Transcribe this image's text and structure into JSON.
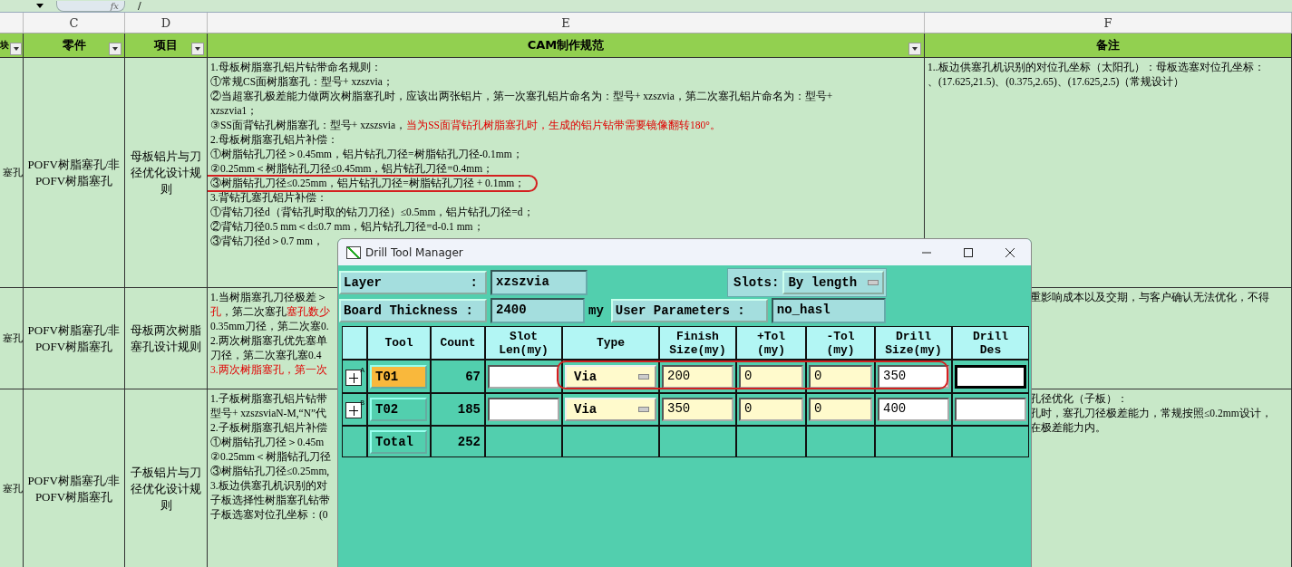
{
  "formula_bar": {
    "fx_label": "fx",
    "formula": "/"
  },
  "column_letters": [
    "C",
    "D",
    "E",
    "F"
  ],
  "header_row": [
    {
      "label": "块",
      "filter": true
    },
    {
      "label": "零件",
      "filter": true
    },
    {
      "label": "项目",
      "filter": true
    },
    {
      "label": "CAM制作规范",
      "filter": true
    },
    {
      "label": "备注",
      "filter": false
    }
  ],
  "rows": [
    {
      "module": "塞孔",
      "part": "POFV树脂塞孔/非POFV树脂塞孔",
      "item": "母板铝片与刀径优化设计规则",
      "spec": [
        {
          "segments": [
            {
              "text": "1.母板树脂塞孔铝片钻带命名规则：",
              "red": false
            }
          ]
        },
        {
          "segments": [
            {
              "text": "①常规CS面树脂塞孔：型号+ xzszvia；",
              "red": false
            }
          ]
        },
        {
          "segments": [
            {
              "text": "②当超塞孔极差能力做两次树脂塞孔时，应该出两张铝片，第一次塞孔铝片命名为：型号+ xzszvia，第二次塞孔铝片命名为：型号+",
              "red": false
            }
          ]
        },
        {
          "segments": [
            {
              "text": "xzszvia1；",
              "red": false
            }
          ]
        },
        {
          "segments": [
            {
              "text": "③SS面背钻孔树脂塞孔：型号+ xzszsvia，",
              "red": false
            },
            {
              "text": "当为SS面背钻孔树脂塞孔时，生成的铝片钻带需要镜像翻转180°。",
              "red": true
            }
          ]
        },
        {
          "segments": [
            {
              "text": "2.母板树脂塞孔铝片补偿：",
              "red": false
            }
          ]
        },
        {
          "segments": [
            {
              "text": "①树脂钻孔刀径＞0.45mm，铝片钻孔刀径=树脂钻孔刀径-0.1mm；",
              "red": false
            }
          ]
        },
        {
          "segments": [
            {
              "text": "②0.25mm＜树脂钻孔刀径≤0.45mm，铝片钻孔刀径=0.4mm；",
              "red": false
            }
          ]
        },
        {
          "segments": [
            {
              "text": "③树脂钻孔刀径≤0.25mm，铝片钻孔刀径=树脂钻孔刀径 + 0.1mm；",
              "red": false
            }
          ],
          "annotated": true
        },
        {
          "segments": [
            {
              "text": "3.背钻孔塞孔铝片补偿：",
              "red": false
            }
          ]
        },
        {
          "segments": [
            {
              "text": "①背钻刀径d（背钻孔时取的钻刀刀径）≤0.5mm，铝片钻孔刀径=d；",
              "red": false
            }
          ]
        },
        {
          "segments": [
            {
              "text": "②背钻刀径0.5 mm＜d≤0.7 mm，铝片钻孔刀径=d-0.1 mm；",
              "red": false
            }
          ]
        },
        {
          "segments": [
            {
              "text": "③背钻刀径d＞0.7 mm，",
              "red": false
            }
          ]
        }
      ],
      "note": [
        "1..板边供塞孔机识别的对位孔坐标（太阳孔）：母板选塞对位孔坐标：",
        "、(17.625,21.5)、(0.375,2.65)、(17.625,2.5)（常规设计）"
      ]
    },
    {
      "module": "塞孔",
      "part": "POFV树脂塞孔/非POFV树脂塞孔",
      "item": "母板两次树脂塞孔设计规则",
      "spec": [
        {
          "segments": [
            {
              "text": "1.当树脂塞孔刀径极差＞",
              "red": false
            }
          ]
        },
        {
          "segments": [
            {
              "text": "孔",
              "red": true
            },
            {
              "text": "，第二次塞孔",
              "red": false
            },
            {
              "text": "塞孔数少",
              "red": true
            }
          ]
        },
        {
          "segments": [
            {
              "text": "0.35mm刀径，第二次塞0.",
              "red": false
            }
          ]
        },
        {
          "segments": [
            {
              "text": "2.两次树脂塞孔优先塞单",
              "red": false
            }
          ]
        },
        {
          "segments": [
            {
              "text": "刀径，第二次塞孔塞0.4",
              "red": false
            }
          ]
        },
        {
          "segments": [
            {
              "text": "3.两次树脂塞孔，第一次",
              "red": true
            }
          ]
        }
      ],
      "note": [
        "重影响成本以及交期，与客户确认无法优化，不得"
      ]
    },
    {
      "module": "塞孔",
      "part": "POFV树脂塞孔/非POFV树脂塞孔",
      "item": "子板铝片与刀径优化设计规则",
      "spec": [
        {
          "segments": [
            {
              "text": "1.子板树脂塞孔铝片钻带",
              "red": false
            }
          ]
        },
        {
          "segments": [
            {
              "text": "型号+ xzszsviaN-M,“N”代",
              "red": false
            }
          ]
        },
        {
          "segments": [
            {
              "text": "2.子板树脂塞孔铝片补偿",
              "red": false
            }
          ]
        },
        {
          "segments": [
            {
              "text": "①树脂钻孔刀径＞0.45m",
              "red": false
            }
          ]
        },
        {
          "segments": [
            {
              "text": "②0.25mm＜树脂钻孔刀径",
              "red": false
            }
          ]
        },
        {
          "segments": [
            {
              "text": "③树脂钻孔刀径≤0.25mm,",
              "red": false
            }
          ]
        },
        {
          "segments": [
            {
              "text": "3.板边供塞孔机识别的对",
              "red": false
            }
          ]
        },
        {
          "segments": [
            {
              "text": "子板选择性树脂塞孔钻带",
              "red": false
            }
          ]
        },
        {
          "segments": [
            {
              "text": "子板选塞对位孔坐标：(0",
              "red": false
            }
          ]
        }
      ],
      "note": [
        "孔径优化（子板）：",
        "孔时，塞孔刀径极差能力，常规按照≤0.2mm设计，",
        "在极差能力内。"
      ]
    }
  ],
  "dialog": {
    "title": "Drill Tool Manager",
    "layer_label": "Layer",
    "layer_colon": ":",
    "layer": "xzszvia",
    "slots_label": "Slots:",
    "slots": "By length",
    "board_thickness_label": "Board Thickness :",
    "board_thickness": "2400",
    "unit": "my",
    "user_params_label": "User Parameters :",
    "user_params": "no_hasl",
    "columns": [
      [
        "Tool"
      ],
      [
        "Count"
      ],
      [
        "Slot",
        "Len(my)"
      ],
      [
        "Type"
      ],
      [
        "Finish",
        "Size(my)"
      ],
      [
        "+Tol",
        "(my)"
      ],
      [
        "-Tol",
        "(my)"
      ],
      [
        "Drill",
        "Size(my)"
      ],
      [
        "Drill",
        "Des"
      ]
    ],
    "tools": [
      {
        "marker": "A",
        "tool": "T01",
        "selected": true,
        "count": "67",
        "type": "Via",
        "finish": "200",
        "plus_tol": "0",
        "minus_tol": "0",
        "drill_size": "350",
        "focused": true,
        "annotated": true
      },
      {
        "marker": "B",
        "tool": "T02",
        "selected": false,
        "count": "185",
        "type": "Via",
        "finish": "350",
        "plus_tol": "0",
        "minus_tol": "0",
        "drill_size": "400",
        "focused": false,
        "annotated": false
      }
    ],
    "total": {
      "label": "Total",
      "count": "252"
    }
  }
}
